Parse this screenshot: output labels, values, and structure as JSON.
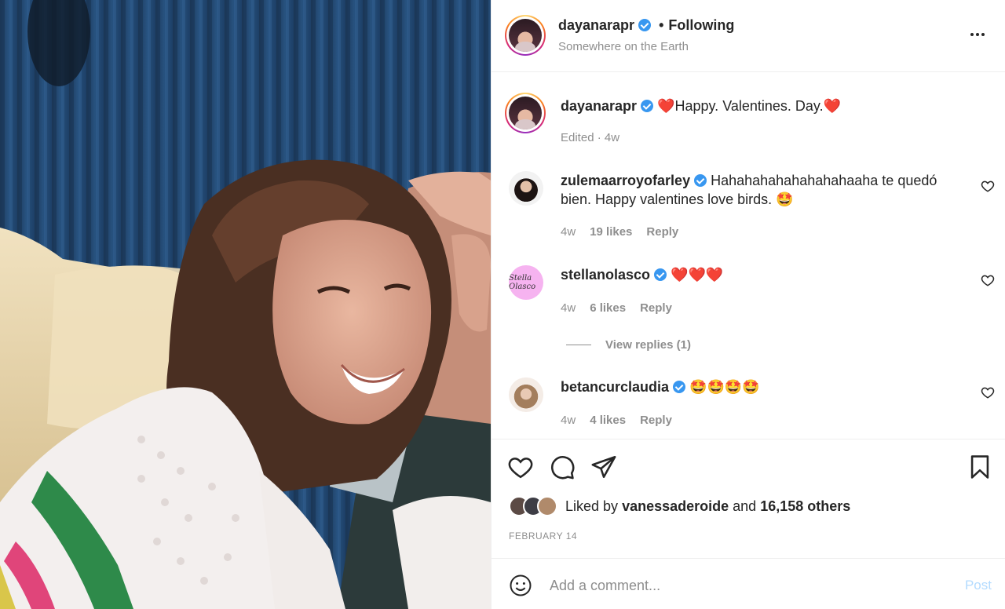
{
  "header": {
    "username": "dayanarapr",
    "separator": "•",
    "follow_status": "Following",
    "location": "Somewhere on the Earth"
  },
  "caption": {
    "username": "dayanarapr",
    "text": "❤️Happy. Valentines. Day.❤️",
    "meta": "Edited · 4w"
  },
  "comments": [
    {
      "username": "zulemaarroyofarley",
      "text": "Hahahahahahahahahaaha te quedó bien. Happy valentines love birds. 🤩",
      "time": "4w",
      "likes": "19 likes",
      "reply": "Reply"
    },
    {
      "username": "stellanolasco",
      "text": "❤️❤️❤️",
      "time": "4w",
      "likes": "6 likes",
      "reply": "Reply",
      "view_replies": "View replies (1)",
      "avatar_text": "Stella Olasco"
    },
    {
      "username": "betancurclaudia",
      "text": "🤩🤩🤩🤩",
      "time": "4w",
      "likes": "4 likes",
      "reply": "Reply"
    }
  ],
  "likes": {
    "prefix": "Liked by",
    "user": "vanessaderoide",
    "connector": "and",
    "others": "16,158 others"
  },
  "post_date": "FEBRUARY 14",
  "comment_box": {
    "placeholder": "Add a comment...",
    "post_label": "Post"
  },
  "colors": {
    "verified": "#3897f0",
    "text": "#262626",
    "muted": "#8e8e8e",
    "post_disabled": "#b3dbff",
    "heart": "#ed1c3a"
  }
}
